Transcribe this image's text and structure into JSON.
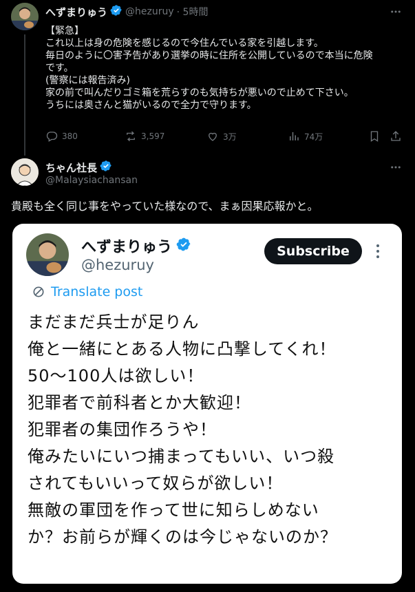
{
  "tweet1": {
    "display_name": "へずまりゅう",
    "handle": "@hezuruy",
    "time": "· 5時間",
    "lines": [
      "【緊急】",
      "これ以上は身の危険を感じるので今住んでいる家を引越します。",
      "毎日のように〇害予告があり選挙の時に住所を公開しているので本当に危険",
      "です。",
      "(警察には報告済み)",
      "家の前で叫んだりゴミ箱を荒らすのも気持ちが悪いので止めて下さい。",
      "うちには奥さんと猫がいるので全力で守ります。"
    ],
    "replies": "380",
    "retweets": "3,597",
    "likes": "3万",
    "views": "74万"
  },
  "tweet2": {
    "display_name": "ちゃん社長",
    "handle": "@Malaysiachansan",
    "text": "貴殿も全く同じ事をやっていた様なので、まぁ因果応報かと。"
  },
  "embedded": {
    "display_name": "へずまりゅう",
    "handle": "@hezuruy",
    "subscribe_label": "Subscribe",
    "translate_label": "Translate post",
    "lines": [
      "まだまだ兵士が足りん",
      "俺と一緒にとある人物に凸撃してくれ！",
      "50〜100人は欲しい！",
      "犯罪者で前科者とか大歓迎！",
      "犯罪者の集団作ろうや！",
      "俺みたいにいつ捕まってもいい、いつ殺",
      "されてもいいって奴らが欲しい！",
      "無敵の軍団を作って世に知らしめない",
      "か？お前らが輝くのは今じゃないのか？"
    ]
  },
  "colors": {
    "verified": "#1d9bf0",
    "muted": "#71767b",
    "background": "#000000"
  }
}
